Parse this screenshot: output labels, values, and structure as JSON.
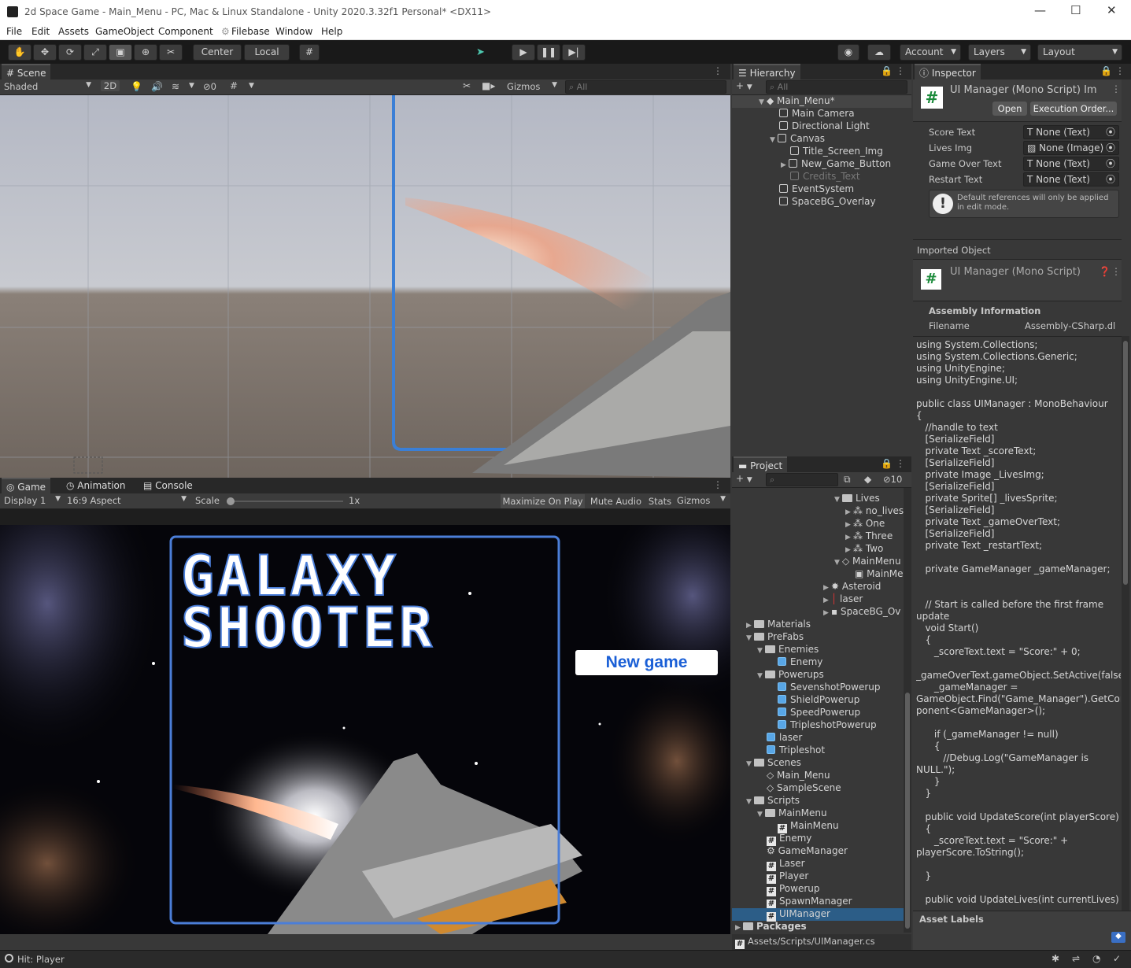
{
  "window": {
    "title": "2d Space Game - Main_Menu - PC, Mac & Linux Standalone - Unity 2020.3.32f1 Personal* <DX11>",
    "minimize": "—",
    "maximize": "☐",
    "close": "✕"
  },
  "menu": [
    "File",
    "Edit",
    "Assets",
    "GameObject",
    "Component",
    "Filebase",
    "Window",
    "Help"
  ],
  "toolbar": {
    "center": "Center",
    "local": "Local",
    "account": "Account",
    "layers": "Layers",
    "layout": "Layout"
  },
  "scene": {
    "tab": "Scene",
    "shading": "Shaded",
    "mode_2d": "2D",
    "hidden_count": "0",
    "gizmos": "Gizmos",
    "search_placeholder": "All"
  },
  "game": {
    "tabs": [
      "Game",
      "Animation",
      "Console"
    ],
    "display": "Display 1",
    "aspect": "16:9 Aspect",
    "scale_label": "Scale",
    "scale_value": "1x",
    "maximize": "Maximize On Play",
    "mute": "Mute Audio",
    "stats": "Stats",
    "gizmos": "Gizmos",
    "title_line1": "GALAXY",
    "title_line2": "SHOOTER",
    "new_game": "New game",
    "scale_level": 0
  },
  "hierarchy": {
    "tab": "Hierarchy",
    "search_placeholder": "All",
    "root": "Main_Menu*",
    "items": [
      "Main Camera",
      "Directional Light",
      "Canvas",
      "Title_Screen_Img",
      "New_Game_Button",
      "Credits_Text",
      "EventSystem",
      "SpaceBG_Overlay"
    ]
  },
  "project": {
    "tab": "Project",
    "count": "10",
    "items": [
      "Lives",
      "no_lives",
      "One",
      "Three",
      "Two",
      "MainMenu",
      "MainMe",
      "Asteroid",
      "laser",
      "SpaceBG_Ov",
      "Materials",
      "PreFabs",
      "Enemies",
      "Enemy",
      "Powerups",
      "SevenshotPowerup",
      "ShieldPowerup",
      "SpeedPowerup",
      "TripleshotPowerup",
      "laser",
      "Tripleshot",
      "Scenes",
      "Main_Menu",
      "SampleScene",
      "Scripts",
      "MainMenu",
      "MainMenu",
      "Enemy",
      "GameManager",
      "Laser",
      "Player",
      "Powerup",
      "SpawnManager",
      "UIManager",
      "Packages"
    ],
    "path": "Assets/Scripts/UIManager.cs"
  },
  "inspector": {
    "tab": "Inspector",
    "header": "UI Manager (Mono Script) Im",
    "open": "Open",
    "exec_order": "Execution Order...",
    "fields": [
      {
        "label": "Score Text",
        "value": "None (Text)"
      },
      {
        "label": "Lives Img",
        "value": "None (Image)"
      },
      {
        "label": "Game Over Text",
        "value": "None (Text)"
      },
      {
        "label": "Restart Text",
        "value": "None (Text)"
      }
    ],
    "help": "Default references will only be applied in edit mode.",
    "imported": "Imported Object",
    "imported_title": "UI Manager (Mono Script)",
    "assembly": "Assembly Information",
    "filename_label": "Filename",
    "filename_value": "Assembly-CSharp.dl",
    "asset_labels": "Asset Labels",
    "code": [
      "using System.Collections;",
      "using System.Collections.Generic;",
      "using UnityEngine;",
      "using UnityEngine.UI;",
      "",
      "public class UIManager : MonoBehaviour",
      "{",
      "   //handle to text",
      "   [SerializeField]",
      "   private Text _scoreText;",
      "   [SerializeField]",
      "   private Image _LivesImg;",
      "   [SerializeField]",
      "   private Sprite[] _livesSprite;",
      "   [SerializeField]",
      "   private Text _gameOverText;",
      "   [SerializeField]",
      "   private Text _restartText;",
      "",
      "   private GameManager _gameManager;",
      "",
      "",
      "   // Start is called before the first frame",
      "update",
      "   void Start()",
      "   {",
      "      _scoreText.text = \"Score:\" + 0;",
      "",
      "_gameOverText.gameObject.SetActive(false);",
      "      _gameManager =",
      "GameObject.Find(\"Game_Manager\").GetCom",
      "ponent<GameManager>();",
      "",
      "      if (_gameManager != null)",
      "      {",
      "         //Debug.Log(\"GameManager is",
      "NULL.\");",
      "      }",
      "   }",
      "",
      "   public void UpdateScore(int playerScore)",
      "   {",
      "      _scoreText.text = \"Score:\" +",
      "playerScore.ToString();",
      "",
      "   }",
      "",
      "   public void UpdateLives(int currentLives)"
    ]
  },
  "status": {
    "text": "Hit: Player"
  }
}
